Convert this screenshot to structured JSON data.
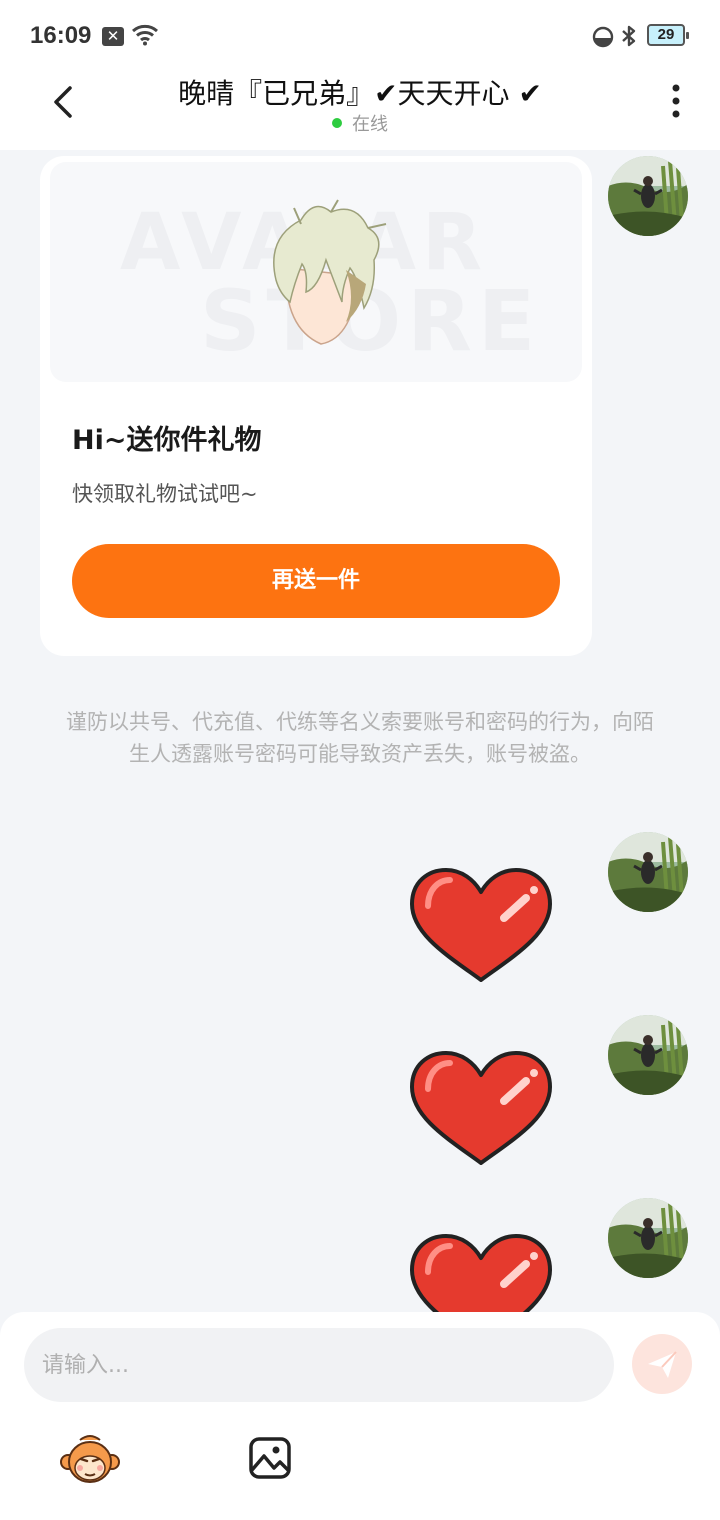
{
  "status_bar": {
    "time": "16:09",
    "notification_badge": "✕",
    "battery_level": "29"
  },
  "header": {
    "title": "晚晴『已兄弟』✔天天开心 ✔",
    "status": "在线"
  },
  "gift_card": {
    "watermark_line1": "AVATAR",
    "watermark_line2": "STORE",
    "title": "Hi~送你件礼物",
    "subtitle": "快领取礼物试试吧~",
    "button_label": "再送一件"
  },
  "notice": {
    "text": "谨防以共号、代充值、代练等名义索要账号和密码的行为，向陌生人透露账号密码可能导致资产丢失，账号被盗。"
  },
  "input_bar": {
    "placeholder": "请输入..."
  },
  "colors": {
    "accent": "#fd7311",
    "online": "#2ecc40",
    "heart": "#e53a2e",
    "send_button": "#fde4dd"
  },
  "icons": {
    "back": "chevron-left-icon",
    "more": "more-vertical-icon",
    "send": "paper-plane-icon",
    "sticker": "monkey-emoji-icon",
    "image": "image-icon"
  }
}
